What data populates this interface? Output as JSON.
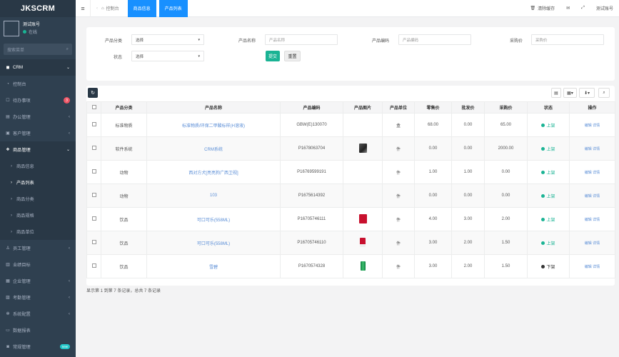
{
  "app": {
    "brand": "JKSCRM"
  },
  "user": {
    "name": "测试账号",
    "status": "在线"
  },
  "sidebar": {
    "search_placeholder": "搜索菜单",
    "items": [
      {
        "label": "CRM",
        "icon": "home-icon"
      },
      {
        "label": "控制台",
        "icon": "dashboard-icon"
      },
      {
        "label": "待办事项",
        "icon": "todo-icon",
        "badge": "3"
      },
      {
        "label": "办公管理",
        "icon": "office-icon"
      },
      {
        "label": "客户管理",
        "icon": "customer-icon"
      },
      {
        "label": "商品管理",
        "icon": "product-icon"
      },
      {
        "label": "商品信息"
      },
      {
        "label": "产品列表"
      },
      {
        "label": "商品分类"
      },
      {
        "label": "商品规格"
      },
      {
        "label": "商品单位"
      },
      {
        "label": "员工管理",
        "icon": "staff-icon"
      },
      {
        "label": "业绩目标",
        "icon": "target-icon"
      },
      {
        "label": "企业管理",
        "icon": "company-icon"
      },
      {
        "label": "考勤管理",
        "icon": "attendance-icon"
      },
      {
        "label": "系统配置",
        "icon": "settings-icon"
      },
      {
        "label": "数据报表",
        "icon": "report-icon"
      },
      {
        "label": "常规管理",
        "icon": "manage-icon",
        "badge": "new"
      }
    ]
  },
  "topbar": {
    "tabs": [
      "控制台",
      "商品信息",
      "产品列表"
    ],
    "clear_cache": "清除缓存",
    "account": "测试账号"
  },
  "filters": {
    "category_label": "产品分类",
    "category_value": "选择",
    "name_label": "产品名称",
    "name_placeholder": "产品名称",
    "code_label": "产品编码",
    "code_placeholder": "产品编码",
    "price_label": "采购价",
    "price_placeholder": "采购价",
    "status_label": "状态",
    "status_value": "选择",
    "submit": "提交",
    "reset": "重置"
  },
  "table": {
    "columns": [
      "产品分类",
      "产品名称",
      "产品编码",
      "产品图片",
      "产品单位",
      "零售价",
      "批发价",
      "采购价",
      "状态",
      "操作"
    ],
    "rows": [
      {
        "category": "标准物质",
        "name": "标准物质/环保二甲酸标样(H溶液)",
        "code": "GBW(E)130070",
        "image": "",
        "unit": "盒",
        "retail": "68.00",
        "wholesale": "0.00",
        "purchase": "65.00",
        "status": "上架",
        "status_color": "#1ab394",
        "ops": "编辑 详情"
      },
      {
        "category": "软件系统",
        "name": "CRM系统",
        "code": "P1678063704",
        "image": "photo",
        "unit": "件",
        "retail": "0.00",
        "wholesale": "0.00",
        "purchase": "2000.00",
        "status": "上架",
        "status_color": "#1ab394",
        "ops": "编辑 详情"
      },
      {
        "category": "动物",
        "name": "西对方犬[亮亮狗广西卫视]",
        "code": "P16769599191",
        "image": "",
        "unit": "件",
        "retail": "1.00",
        "wholesale": "1.00",
        "purchase": "0.00",
        "status": "上架",
        "status_color": "#1ab394",
        "ops": "编辑 详情"
      },
      {
        "category": "动物",
        "name": "103",
        "code": "P1675614392",
        "image": "",
        "unit": "件",
        "retail": "0.00",
        "wholesale": "0.00",
        "purchase": "0.00",
        "status": "上架",
        "status_color": "#1ab394",
        "ops": "编辑 详情"
      },
      {
        "category": "饮品",
        "name": "可口可乐(558ML)",
        "code": "P16705746111",
        "image": "red-can",
        "unit": "件",
        "retail": "4.00",
        "wholesale": "3.00",
        "purchase": "2.00",
        "status": "上架",
        "status_color": "#1ab394",
        "ops": "编辑 详情"
      },
      {
        "category": "饮品",
        "name": "可口可乐(558ML)",
        "code": "P16705746110",
        "image": "red-cup",
        "unit": "件",
        "retail": "3.00",
        "wholesale": "2.00",
        "purchase": "1.50",
        "status": "上架",
        "status_color": "#1ab394",
        "ops": "编辑 详情"
      },
      {
        "category": "饮品",
        "name": "雪碧",
        "code": "P1670574328",
        "image": "green-can",
        "unit": "件",
        "retail": "3.00",
        "wholesale": "2.00",
        "purchase": "1.50",
        "status": "下架",
        "status_color": "#333333",
        "ops": "编辑 详情"
      }
    ],
    "pager_text": "显示第 1 到第 7 条记录，总共 7 条记录"
  }
}
